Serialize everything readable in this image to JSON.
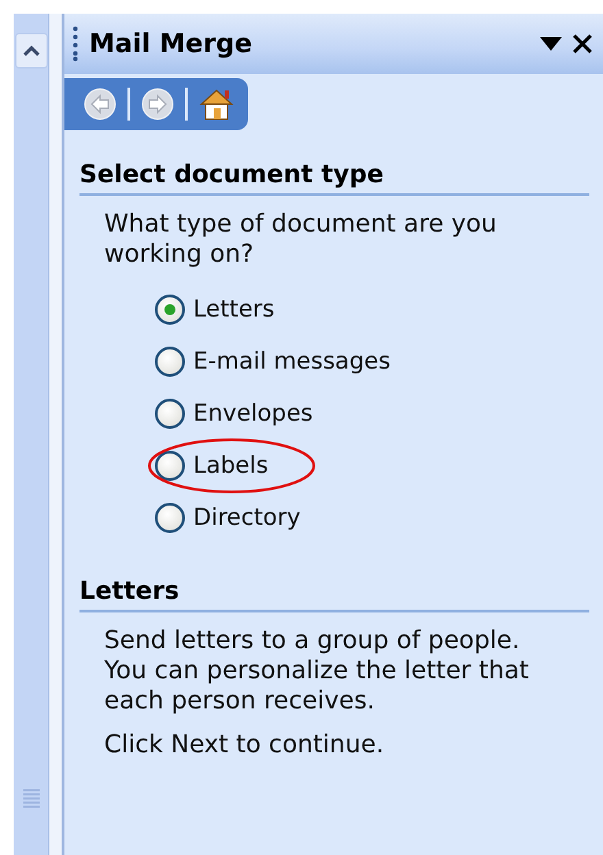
{
  "pane": {
    "title": "Mail Merge"
  },
  "section": {
    "heading": "Select document type",
    "question": "What type of document are you working on?",
    "options": [
      {
        "label": "Letters",
        "selected": true,
        "circled": false
      },
      {
        "label": "E-mail messages",
        "selected": false,
        "circled": false
      },
      {
        "label": "Envelopes",
        "selected": false,
        "circled": false
      },
      {
        "label": "Labels",
        "selected": false,
        "circled": true
      },
      {
        "label": "Directory",
        "selected": false,
        "circled": false
      }
    ]
  },
  "details": {
    "heading": "Letters",
    "paragraphs": [
      "Send letters to a group of people. You can personalize the letter that each person receives.",
      "Click Next to continue."
    ]
  }
}
